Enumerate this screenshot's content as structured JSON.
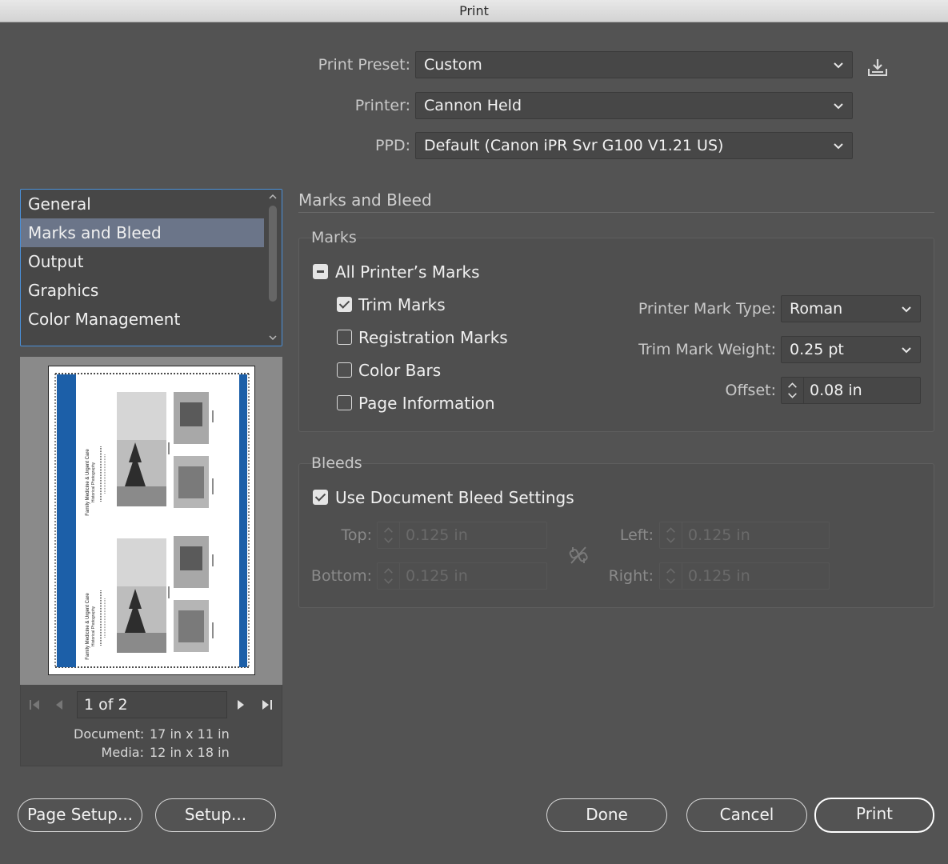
{
  "window": {
    "title": "Print"
  },
  "header": {
    "preset_label": "Print Preset:",
    "preset_value": "Custom",
    "printer_label": "Printer:",
    "printer_value": "Cannon Held",
    "ppd_label": "PPD:",
    "ppd_value": "Default (Canon iPR Svr G100 V1.21 US)",
    "save_preset_icon": "save-preset-icon"
  },
  "sidebar": {
    "items": [
      {
        "label": "General",
        "selected": false
      },
      {
        "label": "Marks and Bleed",
        "selected": true
      },
      {
        "label": "Output",
        "selected": false
      },
      {
        "label": "Graphics",
        "selected": false
      },
      {
        "label": "Color Management",
        "selected": false
      }
    ]
  },
  "preview": {
    "page_indicator": "1 of 2",
    "document_label": "Document:",
    "document_value": "17 in x 11 in",
    "media_label": "Media:",
    "media_value": "12 in x 18 in",
    "accent_color": "#1c5fa8",
    "thumb_title": "Family Medicine & Urgent Care",
    "thumb_subtitle": "Historical Photography"
  },
  "section": {
    "title": "Marks and Bleed",
    "marks": {
      "group_title": "Marks",
      "all_printers_marks": {
        "label": "All Printer’s Marks",
        "state": "mixed"
      },
      "trim_marks": {
        "label": "Trim Marks",
        "checked": true
      },
      "registration_marks": {
        "label": "Registration Marks",
        "checked": false
      },
      "color_bars": {
        "label": "Color Bars",
        "checked": false
      },
      "page_information": {
        "label": "Page Information",
        "checked": false
      },
      "mark_type_label": "Printer Mark Type:",
      "mark_type_value": "Roman",
      "trim_weight_label": "Trim Mark Weight:",
      "trim_weight_value": "0.25 pt",
      "offset_label": "Offset:",
      "offset_value": "0.08 in"
    },
    "bleeds": {
      "group_title": "Bleeds",
      "use_doc_bleed": {
        "label": "Use Document Bleed Settings",
        "checked": true
      },
      "top_label": "Top:",
      "top_value": "0.125 in",
      "bottom_label": "Bottom:",
      "bottom_value": "0.125 in",
      "left_label": "Left:",
      "left_value": "0.125 in",
      "right_label": "Right:",
      "right_value": "0.125 in",
      "link_icon": "broken-link-icon"
    }
  },
  "footer": {
    "page_setup": "Page Setup...",
    "setup": "Setup...",
    "done": "Done",
    "cancel": "Cancel",
    "print": "Print"
  }
}
